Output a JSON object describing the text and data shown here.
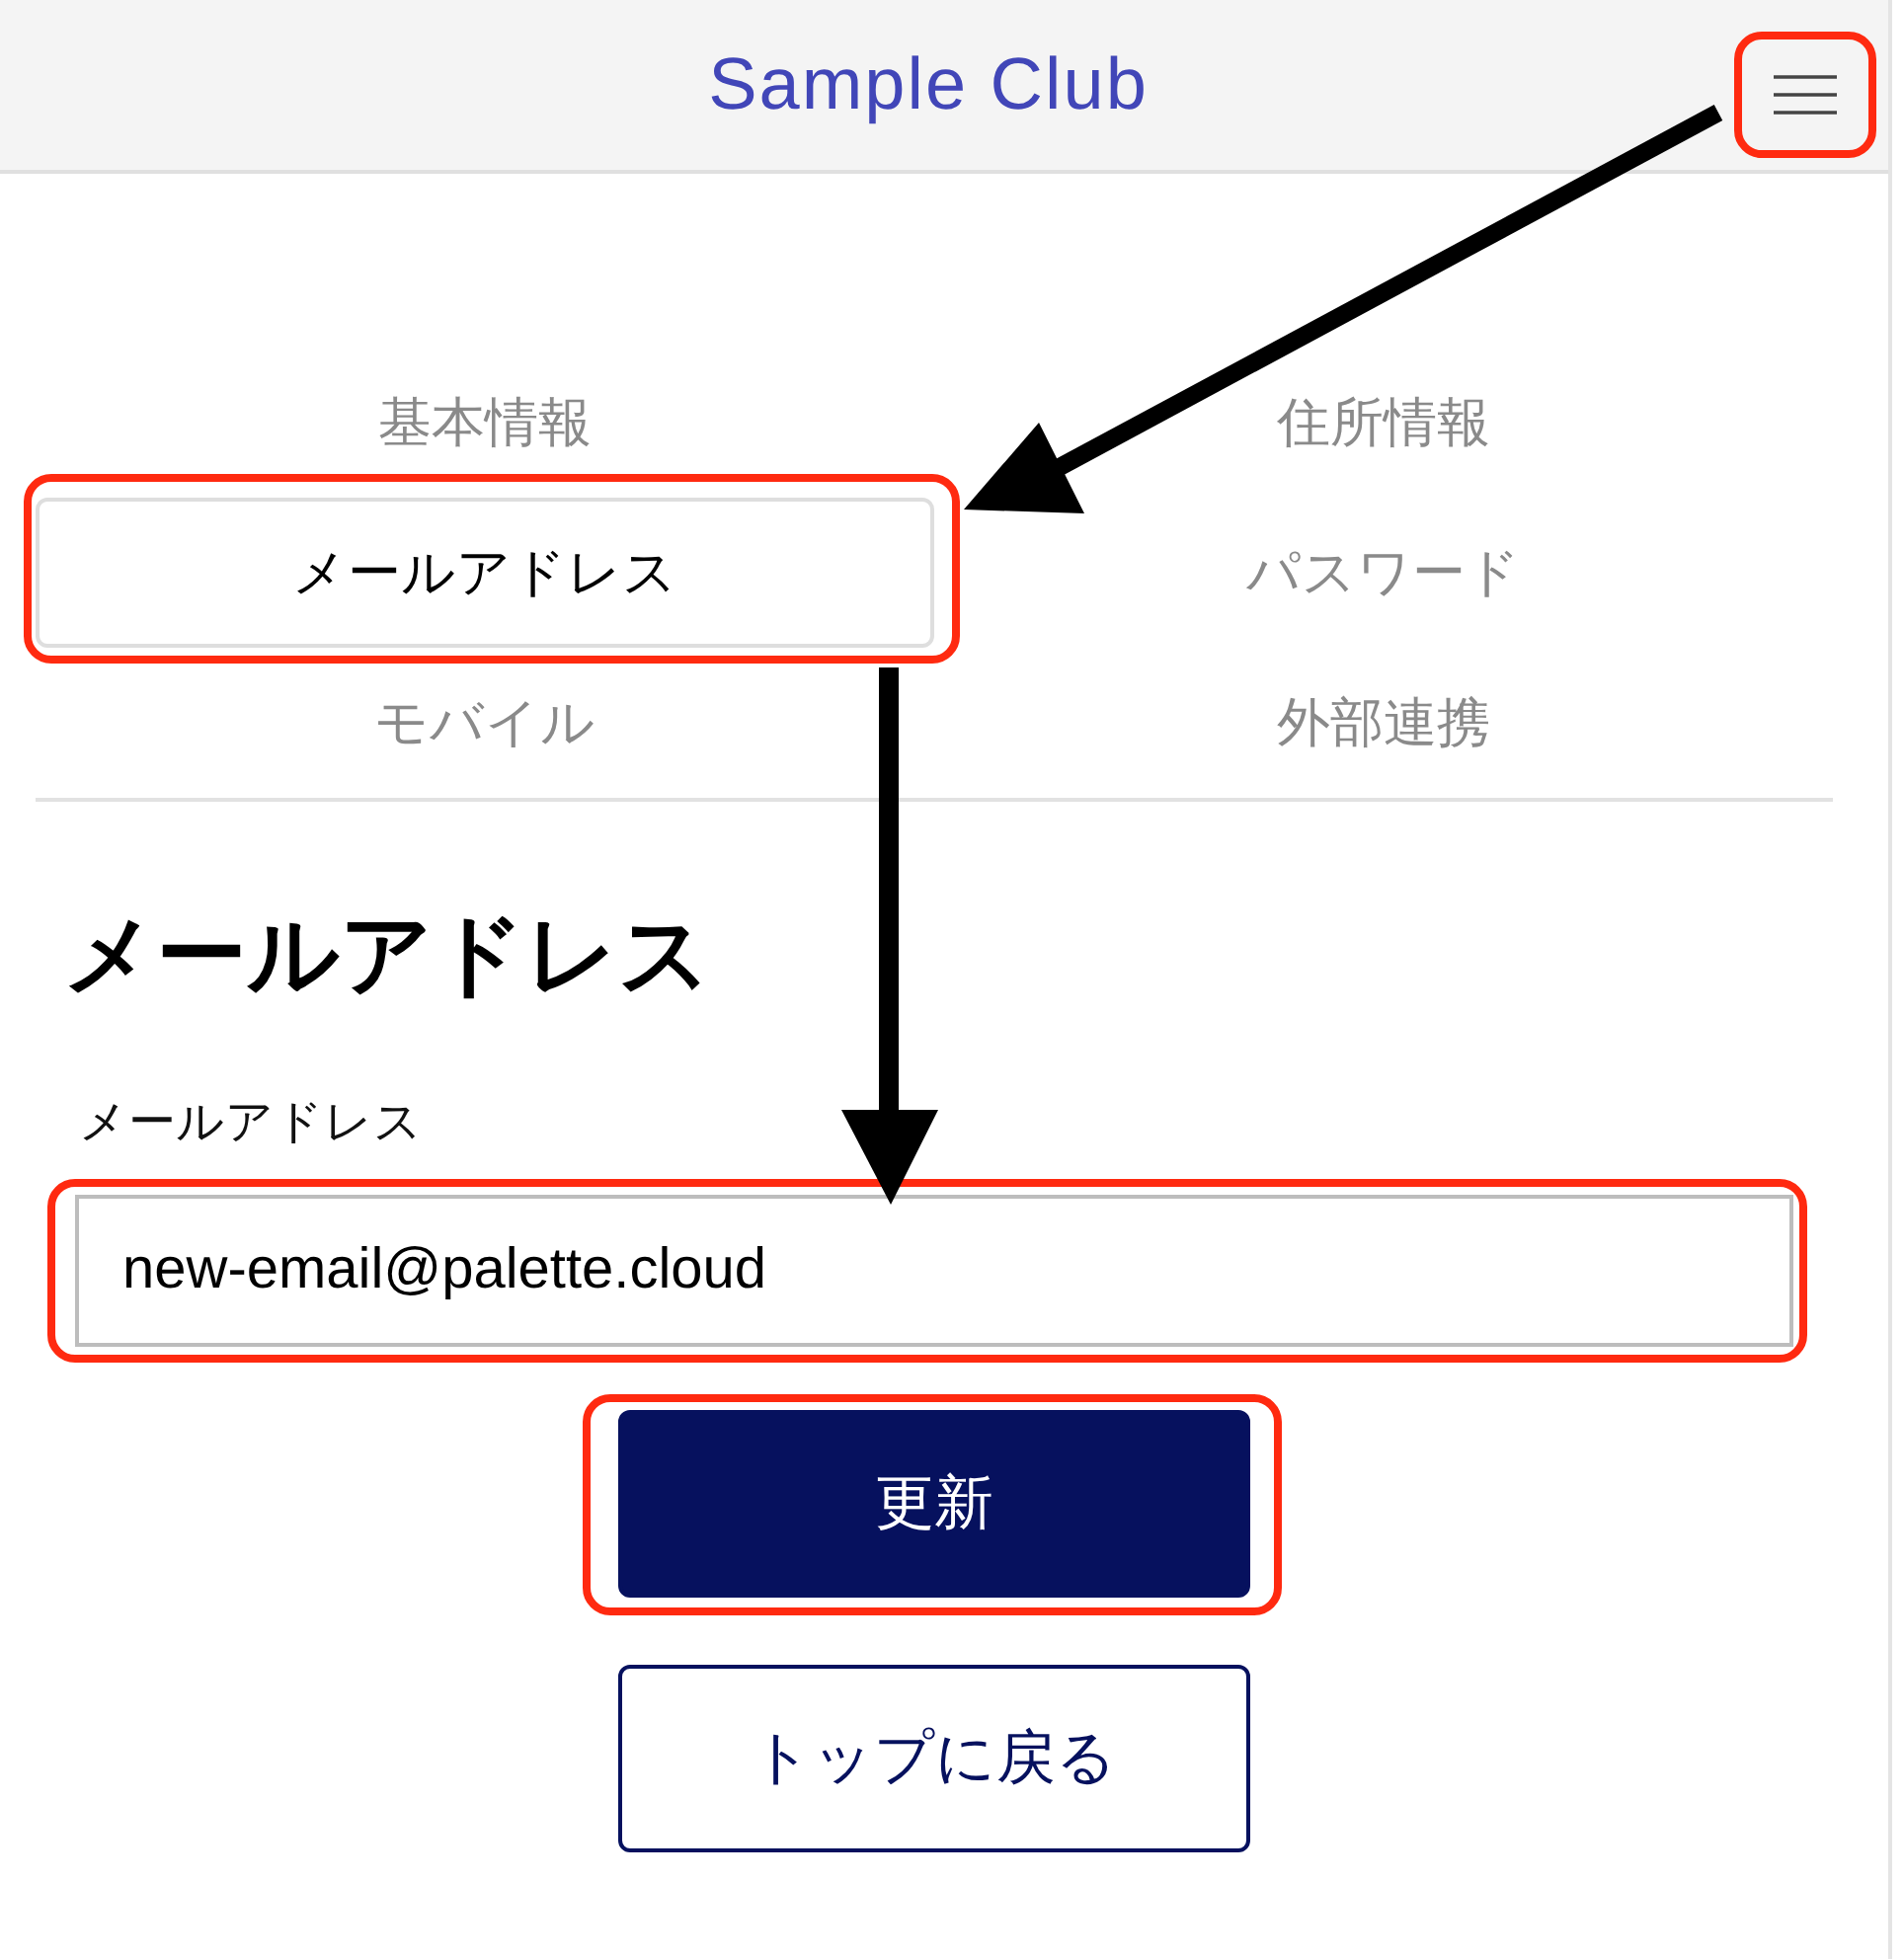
{
  "header": {
    "title": "Sample Club",
    "menu_button": {
      "highlighted": true
    }
  },
  "tabs": [
    {
      "label": "基本情報",
      "selected": false,
      "highlighted": false
    },
    {
      "label": "住所情報",
      "selected": false,
      "highlighted": false
    },
    {
      "label": "メールアドレス",
      "selected": true,
      "highlighted": true
    },
    {
      "label": "パスワード",
      "selected": false,
      "highlighted": false
    },
    {
      "label": "モバイル",
      "selected": false,
      "highlighted": false
    },
    {
      "label": "外部連携",
      "selected": false,
      "highlighted": false
    }
  ],
  "section": {
    "heading": "メールアドレス",
    "field": {
      "label": "メールアドレス",
      "value": "new-email@palette.cloud",
      "highlighted": true
    }
  },
  "buttons": [
    {
      "kind": "primary",
      "label": "更新",
      "highlighted": true
    },
    {
      "kind": "secondary",
      "label": "トップに戻る",
      "highlighted": false
    }
  ]
}
